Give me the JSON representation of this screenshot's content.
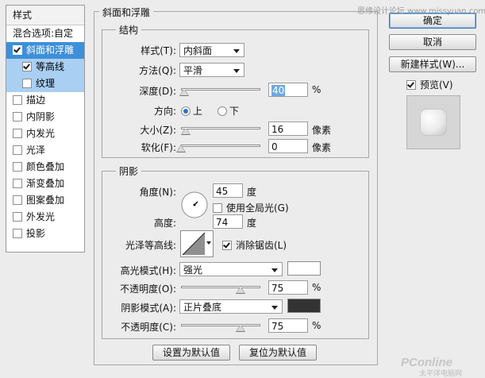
{
  "watermark_top": "思缘设计论坛 www.missyuan.com",
  "watermark_bottom": {
    "brand": "PConline",
    "sub": "太平洋电脑网"
  },
  "sidebar": {
    "header": "样式",
    "blend_options": "混合选项:自定",
    "items": [
      {
        "label": "斜面和浮雕",
        "checked": true,
        "state": "selected"
      },
      {
        "label": "等高线",
        "checked": true,
        "state": "sub"
      },
      {
        "label": "纹理",
        "checked": false,
        "state": "sub"
      },
      {
        "label": "描边",
        "checked": false
      },
      {
        "label": "内阴影",
        "checked": false
      },
      {
        "label": "内发光",
        "checked": false
      },
      {
        "label": "光泽",
        "checked": false
      },
      {
        "label": "颜色叠加",
        "checked": false
      },
      {
        "label": "渐变叠加",
        "checked": false
      },
      {
        "label": "图案叠加",
        "checked": false
      },
      {
        "label": "外发光",
        "checked": false
      },
      {
        "label": "投影",
        "checked": false
      }
    ]
  },
  "panel": {
    "title": "斜面和浮雕",
    "structure": {
      "title": "结构",
      "style_label": "样式(T):",
      "style_value": "内斜面",
      "technique_label": "方法(Q):",
      "technique_value": "平滑",
      "depth_label": "深度(D):",
      "depth_value": "40",
      "depth_unit": "%",
      "depth_fraction": 0.04,
      "direction_label": "方向:",
      "direction_up": "上",
      "direction_down": "下",
      "size_label": "大小(Z):",
      "size_value": "16",
      "size_unit": "像素",
      "size_fraction": 0.06,
      "soften_label": "软化(F):",
      "soften_value": "0",
      "soften_unit": "像素",
      "soften_fraction": 0.0
    },
    "shading": {
      "title": "阴影",
      "angle_label": "角度(N):",
      "angle_value": "45",
      "angle_unit": "度",
      "global_light_label": "使用全局光(G)",
      "global_light_checked": false,
      "altitude_label": "高度:",
      "altitude_value": "74",
      "altitude_unit": "度",
      "gloss_contour_label": "光泽等高线:",
      "antialias_label": "消除锯齿(L)",
      "antialias_checked": true,
      "highlight_mode_label": "高光模式(H):",
      "highlight_mode_value": "强光",
      "highlight_color": "#ffffff",
      "highlight_opacity_label": "不透明度(O):",
      "highlight_opacity_value": "75",
      "highlight_opacity_unit": "%",
      "highlight_opacity_fraction": 0.75,
      "shadow_mode_label": "阴影模式(A):",
      "shadow_mode_value": "正片叠底",
      "shadow_color": "#333333",
      "shadow_opacity_label": "不透明度(C):",
      "shadow_opacity_value": "75",
      "shadow_opacity_unit": "%",
      "shadow_opacity_fraction": 0.75
    },
    "make_default": "设置为默认值",
    "reset_default": "复位为默认值"
  },
  "actions": {
    "ok": "确定",
    "cancel": "取消",
    "new_style": "新建样式(W)...",
    "preview_label": "预览(V)",
    "preview_checked": true
  }
}
